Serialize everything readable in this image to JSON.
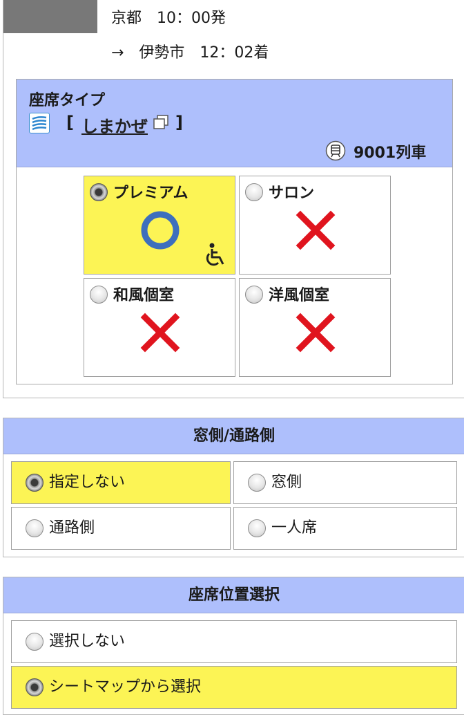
{
  "trip": {
    "departure": "京都　10：00発",
    "arrival": "→　伊勢市　12：02着"
  },
  "seat_type": {
    "title": "座席タイプ",
    "bracket_open": "[",
    "train_name": "しまかぜ",
    "bracket_close": "]",
    "train_number": "9001列車",
    "options": [
      {
        "label": "プレミアム",
        "availability": "○",
        "selected": true,
        "wheelchair": true
      },
      {
        "label": "サロン",
        "availability": "×",
        "selected": false,
        "wheelchair": false
      },
      {
        "label": "和風個室",
        "availability": "×",
        "selected": false,
        "wheelchair": false
      },
      {
        "label": "洋風個室",
        "availability": "×",
        "selected": false,
        "wheelchair": false
      }
    ]
  },
  "window_aisle": {
    "title": "窓側/通路側",
    "options": [
      {
        "label": "指定しない",
        "selected": true
      },
      {
        "label": "窓側",
        "selected": false
      },
      {
        "label": "通路側",
        "selected": false
      },
      {
        "label": "一人席",
        "selected": false
      }
    ]
  },
  "seat_position": {
    "title": "座席位置選択",
    "options": [
      {
        "label": "選択しない",
        "selected": false
      },
      {
        "label": "シートマップから選択",
        "selected": true
      }
    ]
  },
  "colors": {
    "header_blue": "#aebffc",
    "selected_yellow": "#fcf455",
    "available_blue": "#3d6fbd",
    "unavailable_red": "#e0141e"
  },
  "icons": {
    "available": "circle-available-icon",
    "unavailable": "cross-unavailable-icon",
    "wheelchair": "wheelchair-icon",
    "train_logo": "shimakaze-logo-icon",
    "new_window": "new-window-icon",
    "train": "train-icon"
  }
}
